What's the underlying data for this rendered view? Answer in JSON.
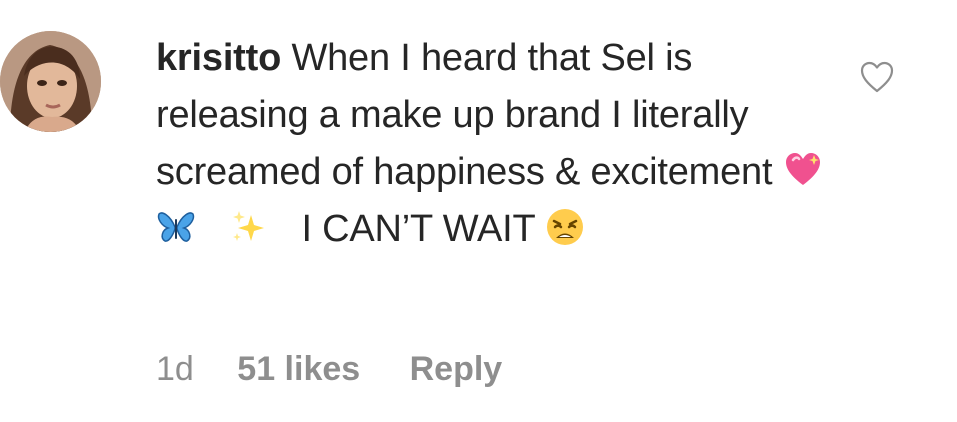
{
  "comment": {
    "username": "krisitto",
    "text_part_1": "When I heard that Sel is releasing a make up brand I literally screamed of happiness & excitement",
    "text_part_2": "I CAN’T WAIT",
    "emojis": [
      "sparkling-heart-icon",
      "butterfly-icon",
      "sparkles-icon",
      "weary-face-icon"
    ]
  },
  "meta": {
    "time": "1d",
    "likes": "51 likes",
    "reply_label": "Reply"
  },
  "colors": {
    "text": "#262626",
    "muted": "#8e8e8e",
    "heart_outline": "#8e8e8e"
  }
}
